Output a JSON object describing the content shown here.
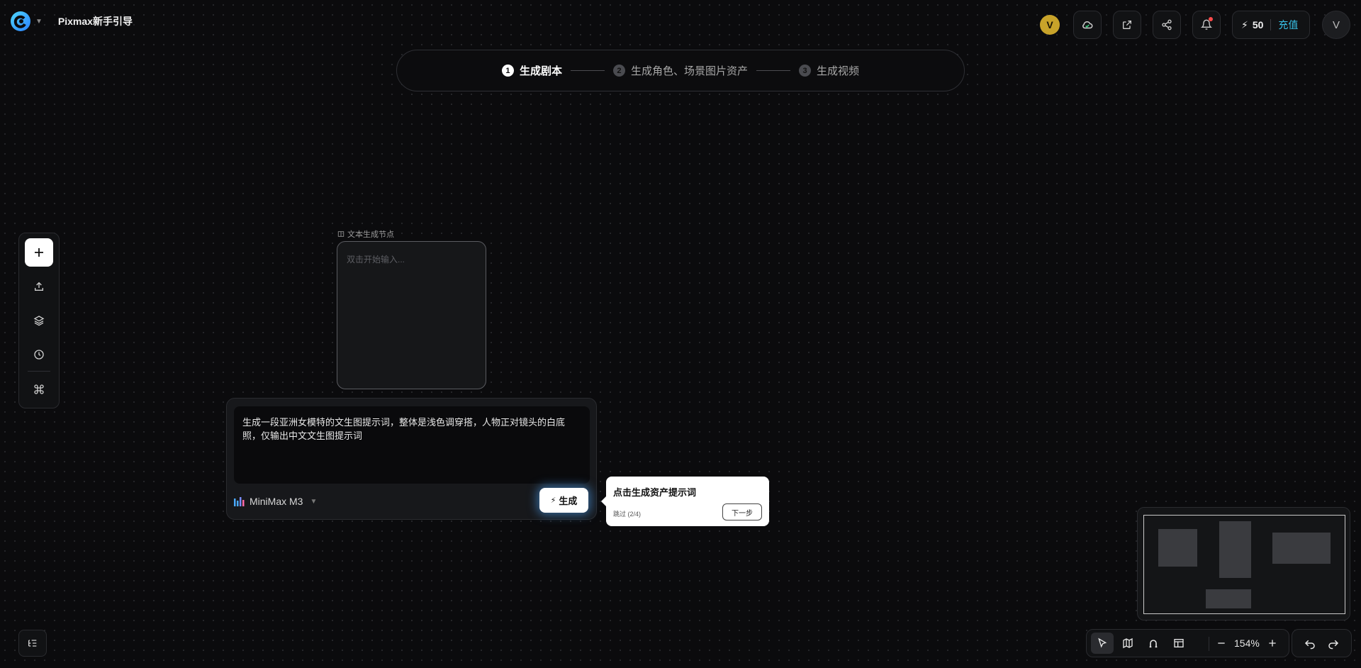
{
  "app": {
    "title": "Pixmax新手引导",
    "logo_icon": "pixmax-logo-icon"
  },
  "header": {
    "user_badge": "V",
    "credits": "50",
    "recharge_label": "充值",
    "avatar_initial": "V",
    "icons": [
      "cloud-sync-icon",
      "external-link-icon",
      "share-icon",
      "bell-icon"
    ]
  },
  "steps": [
    {
      "num": "1",
      "label": "生成剧本",
      "active": true
    },
    {
      "num": "2",
      "label": "生成角色、场景图片资产",
      "active": false
    },
    {
      "num": "3",
      "label": "生成视频",
      "active": false
    }
  ],
  "left_toolbar": {
    "items": [
      "add-icon",
      "upload-icon",
      "layers-icon",
      "history-icon",
      "command-icon"
    ]
  },
  "text_node": {
    "label": "文本生成节点",
    "placeholder": "双击开始输入..."
  },
  "prompt": {
    "text": "生成一段亚洲女模特的文生图提示词，整体是浅色调穿搭，人物正对镜头的白底照，仅输出中文文生图提示词",
    "model": "MiniMax M3",
    "generate_label": "生成"
  },
  "tooltip": {
    "title": "点击生成资产提示词",
    "skip_label": "跳过 (2/4)",
    "next_label": "下一步"
  },
  "canvas": {
    "zoom": "154%"
  }
}
